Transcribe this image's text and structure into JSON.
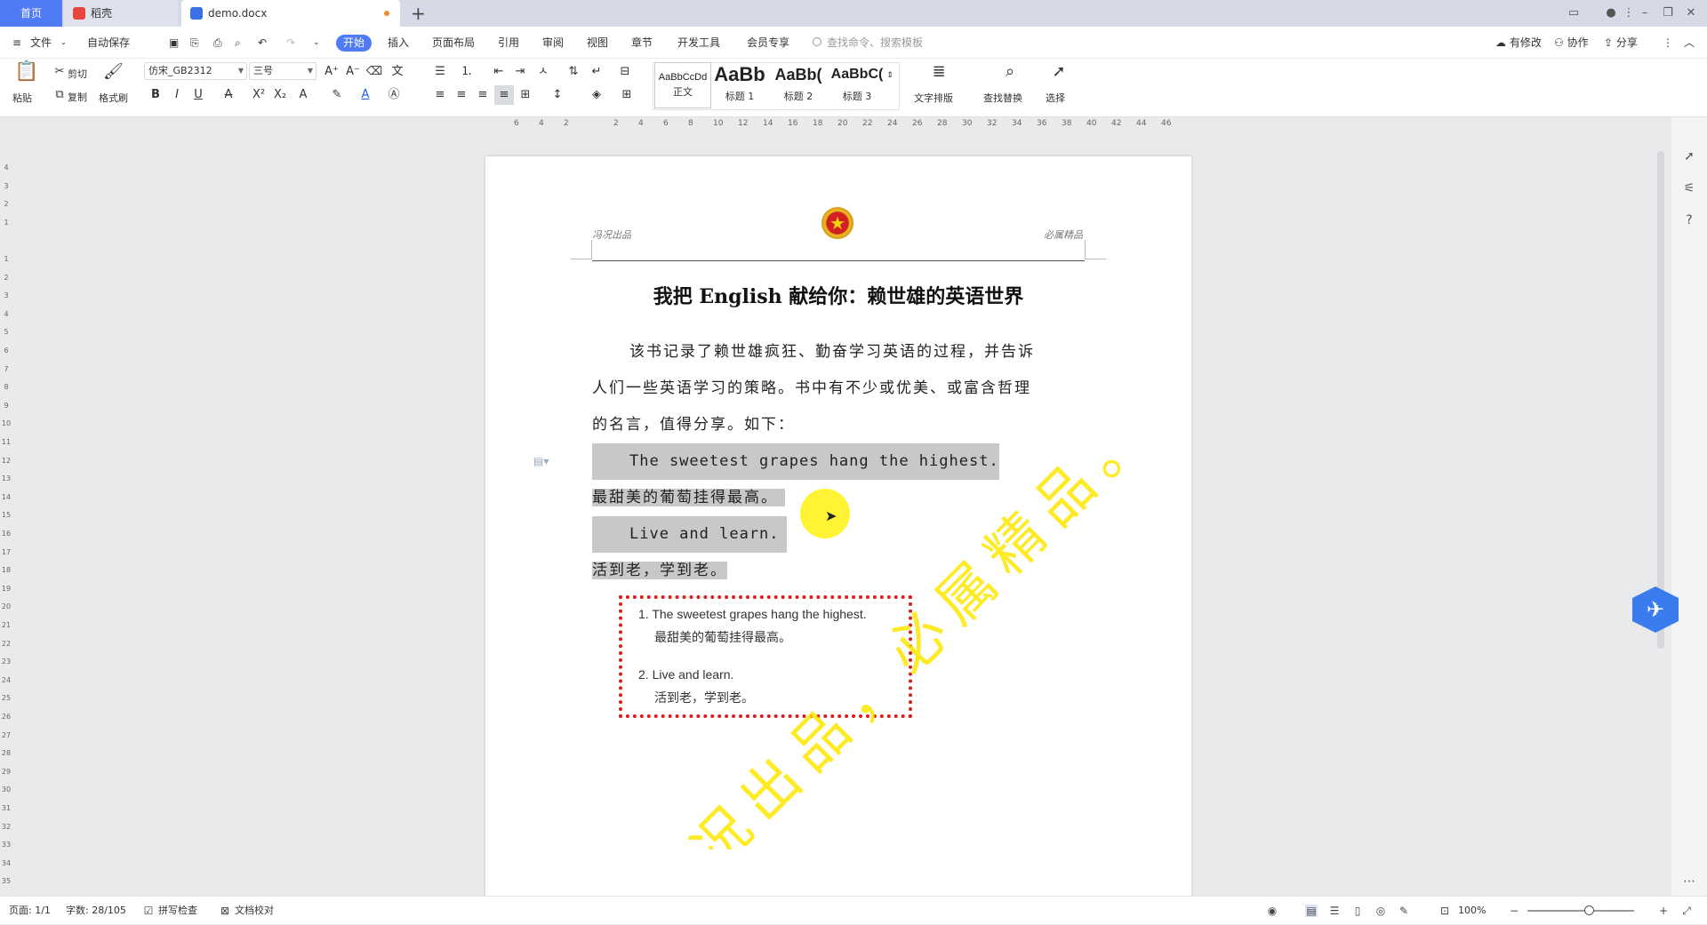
{
  "tabs": {
    "home": "首页",
    "daoke": "稻壳",
    "doc": "demo.docx",
    "add": "+"
  },
  "menubar": {
    "file": "文件",
    "autosave": "自动保存",
    "items": [
      "开始",
      "插入",
      "页面布局",
      "引用",
      "审阅",
      "视图",
      "章节",
      "开发工具",
      "会员专享"
    ],
    "search_placeholder": "查找命令、搜索模板",
    "right": [
      "有修改",
      "协作",
      "分享"
    ]
  },
  "ribbon": {
    "paste": "粘贴",
    "cut": "剪切",
    "copy": "复制",
    "format_painter": "格式刷",
    "font_name": "仿宋_GB2312",
    "font_size": "三号",
    "style_samples": [
      "AaBbCcDd",
      "AaBb",
      "AaBb(",
      "AaBbC("
    ],
    "style_names": [
      "正文",
      "标题 1",
      "标题 2",
      "标题 3"
    ],
    "text_layout": "文字排版",
    "find_replace": "查找替换",
    "select": "选择"
  },
  "ruler": {
    "h_ticks": [
      "6",
      "4",
      "2",
      "",
      "2",
      "4",
      "6",
      "8",
      "10",
      "12",
      "14",
      "16",
      "18",
      "20",
      "22",
      "24",
      "26",
      "28",
      "30",
      "32",
      "34",
      "36",
      "38",
      "40",
      "42",
      "44",
      "46"
    ],
    "v_ticks": [
      "4",
      "3",
      "2",
      "1",
      "",
      "1",
      "2",
      "3",
      "4",
      "5",
      "6",
      "7",
      "8",
      "9",
      "10",
      "11",
      "12",
      "13",
      "14",
      "15",
      "16",
      "17",
      "18",
      "19",
      "20",
      "21",
      "22",
      "23",
      "24",
      "25",
      "26",
      "27",
      "28",
      "29",
      "30",
      "31",
      "32",
      "33",
      "34",
      "35"
    ]
  },
  "document": {
    "header_left": "冯况出品",
    "header_right": "必属精品",
    "title": "我把 English 献给你：赖世雄的英语世界",
    "intro_line1": "该书记录了赖世雄疯狂、勤奋学习英语的过程，并告诉",
    "intro_line2": "人们一些英语学习的策略。书中有不少或优美、或富含哲理",
    "intro_line3": "的名言，值得分享。如下：",
    "quote1_en": "The sweetest grapes hang the highest.",
    "quote1_zh": "最甜美的葡萄挂得最高。",
    "quote2_en": "Live and learn.",
    "quote2_zh": "活到老，学到老。",
    "watermark": "冯况出品，必属精品。",
    "note_items": [
      {
        "num": "1.",
        "en": "The sweetest grapes hang the highest.",
        "zh": "最甜美的葡萄挂得最高。"
      },
      {
        "num": "2.",
        "en": "Live and learn.",
        "zh": "活到老，学到老。"
      }
    ]
  },
  "statusbar": {
    "page": "页面: 1/1",
    "words": "字数: 28/105",
    "spell": "拼写检查",
    "proof": "文档校对",
    "zoom": "100%"
  },
  "colors": {
    "accent": "#4f7bf7",
    "note_border": "#e01a1a",
    "watermark": "#ffe600",
    "highlight": "#c8c8c8"
  }
}
